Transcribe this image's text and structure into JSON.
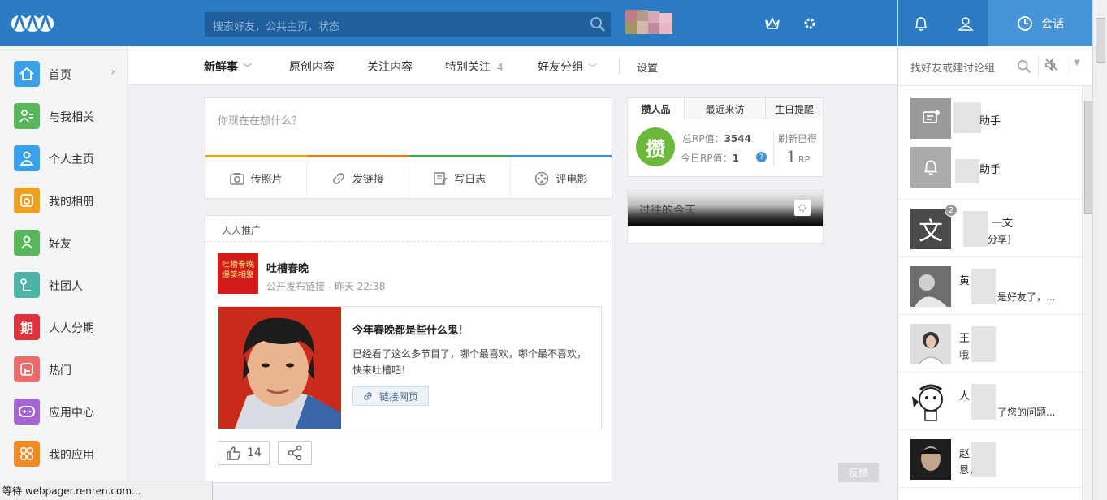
{
  "header": {
    "search_placeholder": "搜索好友，公共主页，状态"
  },
  "sidebar": {
    "items": [
      {
        "label": "首页",
        "color": "#3aa0e8",
        "icon": "home-icon"
      },
      {
        "label": "与我相关",
        "color": "#5ab65a",
        "icon": "related-icon"
      },
      {
        "label": "个人主页",
        "color": "#3aa0e8",
        "icon": "profile-icon"
      },
      {
        "label": "我的相册",
        "color": "#f0a020",
        "icon": "album-icon"
      },
      {
        "label": "好友",
        "color": "#5ab65a",
        "icon": "friends-icon"
      },
      {
        "label": "社团人",
        "color": "#4cb3a6",
        "icon": "club-icon"
      },
      {
        "label": "人人分期",
        "color": "#e0323c",
        "icon": "installment-icon",
        "glyph": "期"
      },
      {
        "label": "热门",
        "color": "#ec6a6a",
        "icon": "hot-icon"
      },
      {
        "label": "应用中心",
        "color": "#a765d4",
        "icon": "app-center-icon"
      },
      {
        "label": "我的应用",
        "color": "#f08a24",
        "icon": "my-apps-icon"
      }
    ]
  },
  "tabs": {
    "items": [
      "新鲜事",
      "原创内容",
      "关注内容",
      "特别关注",
      "好友分组"
    ],
    "special_count": "4",
    "settings": "设置"
  },
  "composer": {
    "placeholder": "你现在在想什么？",
    "actions": [
      "传照片",
      "发链接",
      "写日志",
      "评电影"
    ],
    "bar_colors": [
      "#e8a317",
      "#e37a1d",
      "#3aa656",
      "#3c8ed8"
    ]
  },
  "feed": {
    "header": "人人推广",
    "avatar_text": "吐槽春晚爆笑相聚",
    "author": "吐槽春晚",
    "meta": "公开发布链接 - 昨天 22:38",
    "link_title": "今年春晚都是些什么鬼！",
    "link_desc": "已经看了这么多节目了，哪个最喜欢，哪个最不喜欢，快来吐槽吧！",
    "link_button": "链接网页",
    "likes": "14"
  },
  "rp": {
    "tabs": [
      "攒人品",
      "最近来访",
      "生日提醒"
    ],
    "logo_glyph": "攒",
    "total_label": "总RP值：",
    "total_value": "3544",
    "today_label": "今日RP值：",
    "today_value": "1",
    "help": "?",
    "refresh_label": "刷新已得",
    "refresh_value": "1",
    "refresh_unit": "RP"
  },
  "history": {
    "title": "过往的今天"
  },
  "feedback": "反馈",
  "status": "等待 webpager.renren.com...",
  "chat": {
    "tab_label": "会话",
    "search_placeholder": "找好友或建讨论组",
    "items": [
      {
        "name": "助手",
        "msg": ""
      },
      {
        "name": "助手",
        "msg": ""
      },
      {
        "name": "一文",
        "msg": "分享]",
        "badge": "2"
      },
      {
        "name": "黄",
        "msg": "是好友了，..."
      },
      {
        "name": "王",
        "msg": "哦"
      },
      {
        "name": "人",
        "msg": "了您的问题..."
      },
      {
        "name": "赵",
        "msg": "恩，"
      }
    ]
  }
}
